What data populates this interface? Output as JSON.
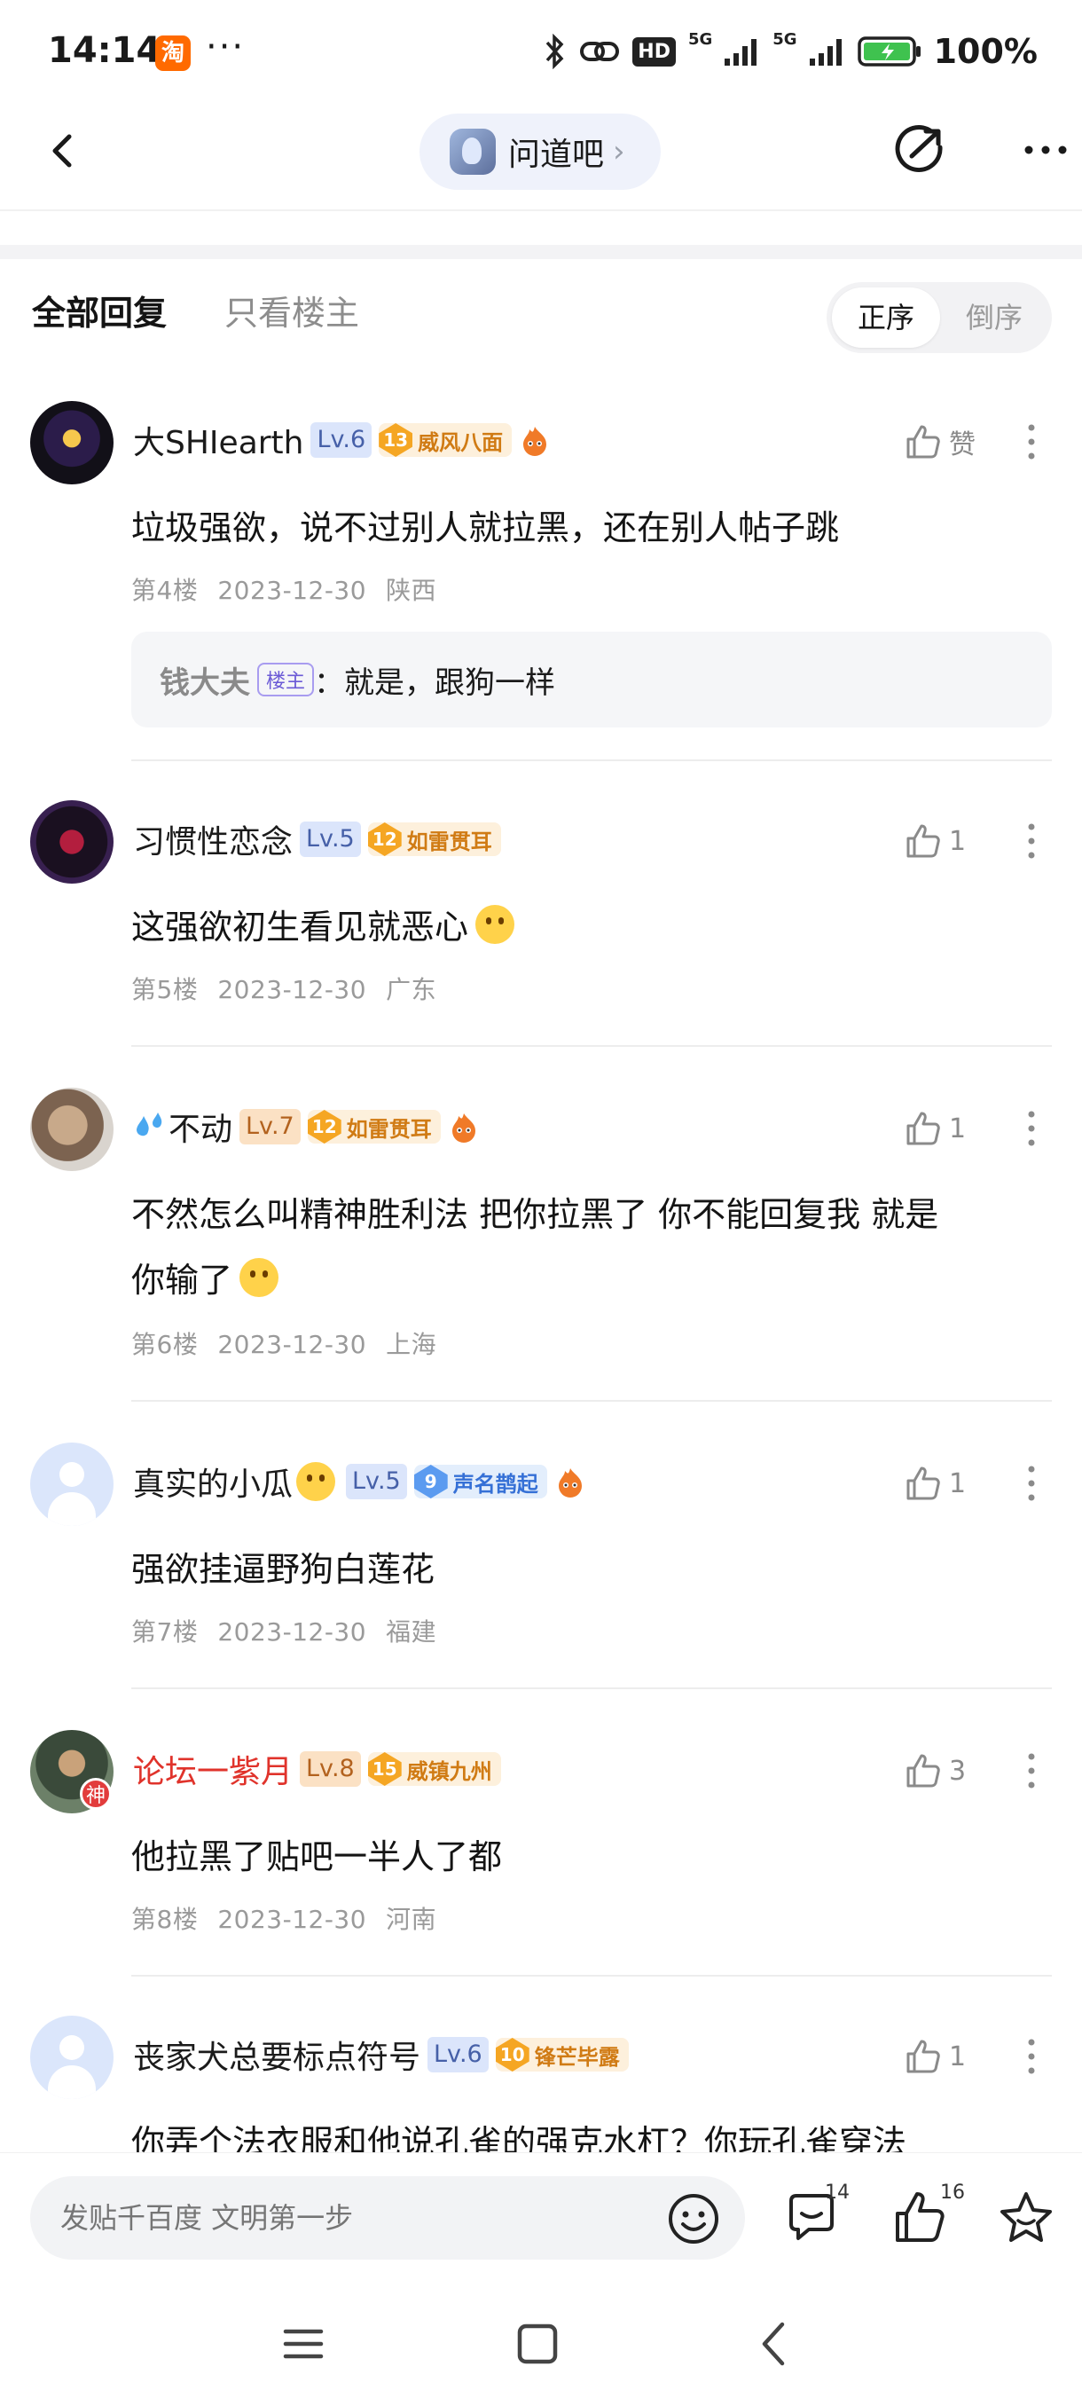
{
  "status_bar": {
    "time": "14:14",
    "app_badge": "淘",
    "dots": "···",
    "hd_label": "HD",
    "network_1": "5G",
    "network_2": "5G",
    "battery": "100%"
  },
  "nav": {
    "forum_name": "问道吧",
    "forum_chevron": "›"
  },
  "tabs": {
    "all": "全部回复",
    "op_only": "只看楼主",
    "sort_asc": "正序",
    "sort_desc": "倒序"
  },
  "replies": [
    {
      "user": "大SHIearth",
      "level": "Lv.6",
      "honor_num": "13",
      "honor_title": "威风八面",
      "like": "赞",
      "content": "垃圾强欲，说不过别人就拉黑，还在别人帖子跳",
      "floor": "第4楼",
      "date": "2023-12-30",
      "location": "陕西",
      "sub_reply": {
        "name": "钱大夫",
        "tag": "楼主",
        "text": "：就是，跟狗一样"
      }
    },
    {
      "user": "习惯性恋念",
      "level": "Lv.5",
      "honor_num": "12",
      "honor_title": "如雷贯耳",
      "like": "1",
      "content": "这强欲初生看见就恶心",
      "floor": "第5楼",
      "date": "2023-12-30",
      "location": "广东"
    },
    {
      "user": "不动",
      "level": "Lv.7",
      "honor_num": "12",
      "honor_title": "如雷贯耳",
      "like": "1",
      "content_line1": "不然怎么叫精神胜利法 把你拉黑了 你不能回复我 就是",
      "content_line2": "你输了",
      "floor": "第6楼",
      "date": "2023-12-30",
      "location": "上海"
    },
    {
      "user": "真实的小瓜",
      "level": "Lv.5",
      "honor_num": "9",
      "honor_title": "声名鹊起",
      "like": "1",
      "content": "强欲挂逼野狗白莲花",
      "floor": "第7楼",
      "date": "2023-12-30",
      "location": "福建"
    },
    {
      "user": "论坛一紫月",
      "level": "Lv.8",
      "honor_num": "15",
      "honor_title": "威镇九州",
      "like": "3",
      "badge": "神",
      "content": "他拉黑了贴吧一半人了都",
      "floor": "第8楼",
      "date": "2023-12-30",
      "location": "河南"
    },
    {
      "user": "丧家犬总要标点符号",
      "level": "Lv.6",
      "honor_num": "10",
      "honor_title": "锋芒毕露",
      "like": "1",
      "content": "你弄个法衣服和他说孔雀的强克水杠？你玩孔雀穿法"
    }
  ],
  "bottom_bar": {
    "input_placeholder": "发贴千百度 文明第一步",
    "comment_count": "14",
    "like_count": "16"
  },
  "colors": {
    "accent_red": "#e0332b",
    "level_blue": "#dbe5fb",
    "honor_gold": "#f5a623",
    "honor_blue": "#5b9bf0"
  }
}
